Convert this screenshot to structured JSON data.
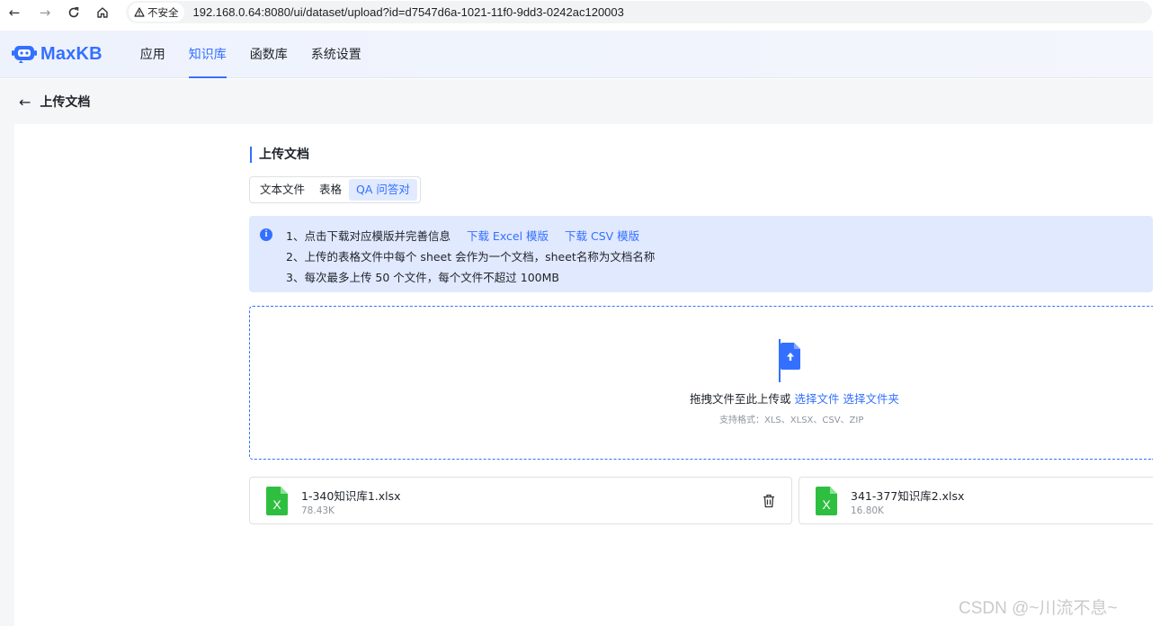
{
  "browser": {
    "security_label": "不安全",
    "url": "192.168.0.64:8080/ui/dataset/upload?id=d7547d6a-1021-11f0-9dd3-0242ac120003"
  },
  "app": {
    "logo_text": "MaxKB",
    "brand_color": "#3370ff",
    "nav": [
      {
        "label": "应用",
        "active": false
      },
      {
        "label": "知识库",
        "active": true
      },
      {
        "label": "函数库",
        "active": false
      },
      {
        "label": "系统设置",
        "active": false
      }
    ]
  },
  "page": {
    "back_title": "上传文档",
    "section_title": "上传文档",
    "tabs": [
      {
        "label": "文本文件",
        "active": false
      },
      {
        "label": "表格",
        "active": false
      },
      {
        "label": "QA 问答对",
        "active": true
      }
    ],
    "alert": {
      "line1_prefix": "1、点击下载对应模版并完善信息",
      "link_excel": "下载 Excel 模版",
      "link_csv": "下载 CSV 模版",
      "line2": "2、上传的表格文件中每个 sheet 会作为一个文档，sheet名称为文档名称",
      "line3": "3、每次最多上传 50 个文件，每个文件不超过 100MB"
    },
    "dropzone": {
      "text_prefix": "拖拽文件至此上传或",
      "link_file": "选择文件",
      "link_folder": "选择文件夹",
      "hint": "支持格式：XLS、XLSX、CSV、ZIP"
    },
    "files": [
      {
        "name": "1-340知识库1.xlsx",
        "size": "78.43K"
      },
      {
        "name": "341-377知识库2.xlsx",
        "size": "16.80K"
      }
    ]
  },
  "watermark": "CSDN @~川流不息~"
}
